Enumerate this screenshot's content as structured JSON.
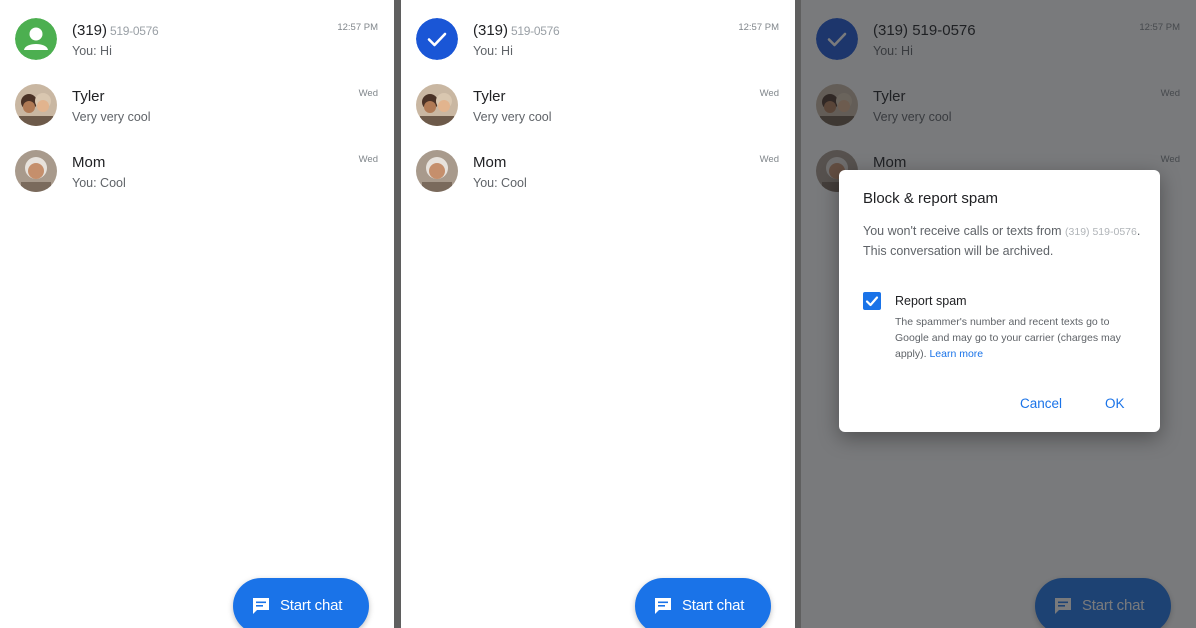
{
  "conversations": [
    {
      "name": "(319)",
      "number": "519-0576",
      "preview": "You: Hi",
      "time": "12:57 PM"
    },
    {
      "name": "Tyler",
      "preview": "Very very cool",
      "time": "Wed"
    },
    {
      "name": "Mom",
      "preview": "You: Cool",
      "time": "Wed"
    }
  ],
  "fab": {
    "label": "Start chat",
    "icon": "chat-icon"
  },
  "dialog": {
    "title": "Block & report spam",
    "body_prefix": "You won't receive calls or texts from",
    "body_number": "(319) 519-0576",
    "body_suffix": ". This conversation will be archived.",
    "checkbox_label": "Report spam",
    "checkbox_checked": true,
    "checkbox_desc": "The spammer's number and recent texts go to Google and may go to your carrier (charges may apply).",
    "learn_more": "Learn more",
    "cancel": "Cancel",
    "ok": "OK"
  },
  "colors": {
    "accent": "#1a73e8",
    "contact_green": "#4caf50",
    "selected_blue": "#1a56d6"
  }
}
